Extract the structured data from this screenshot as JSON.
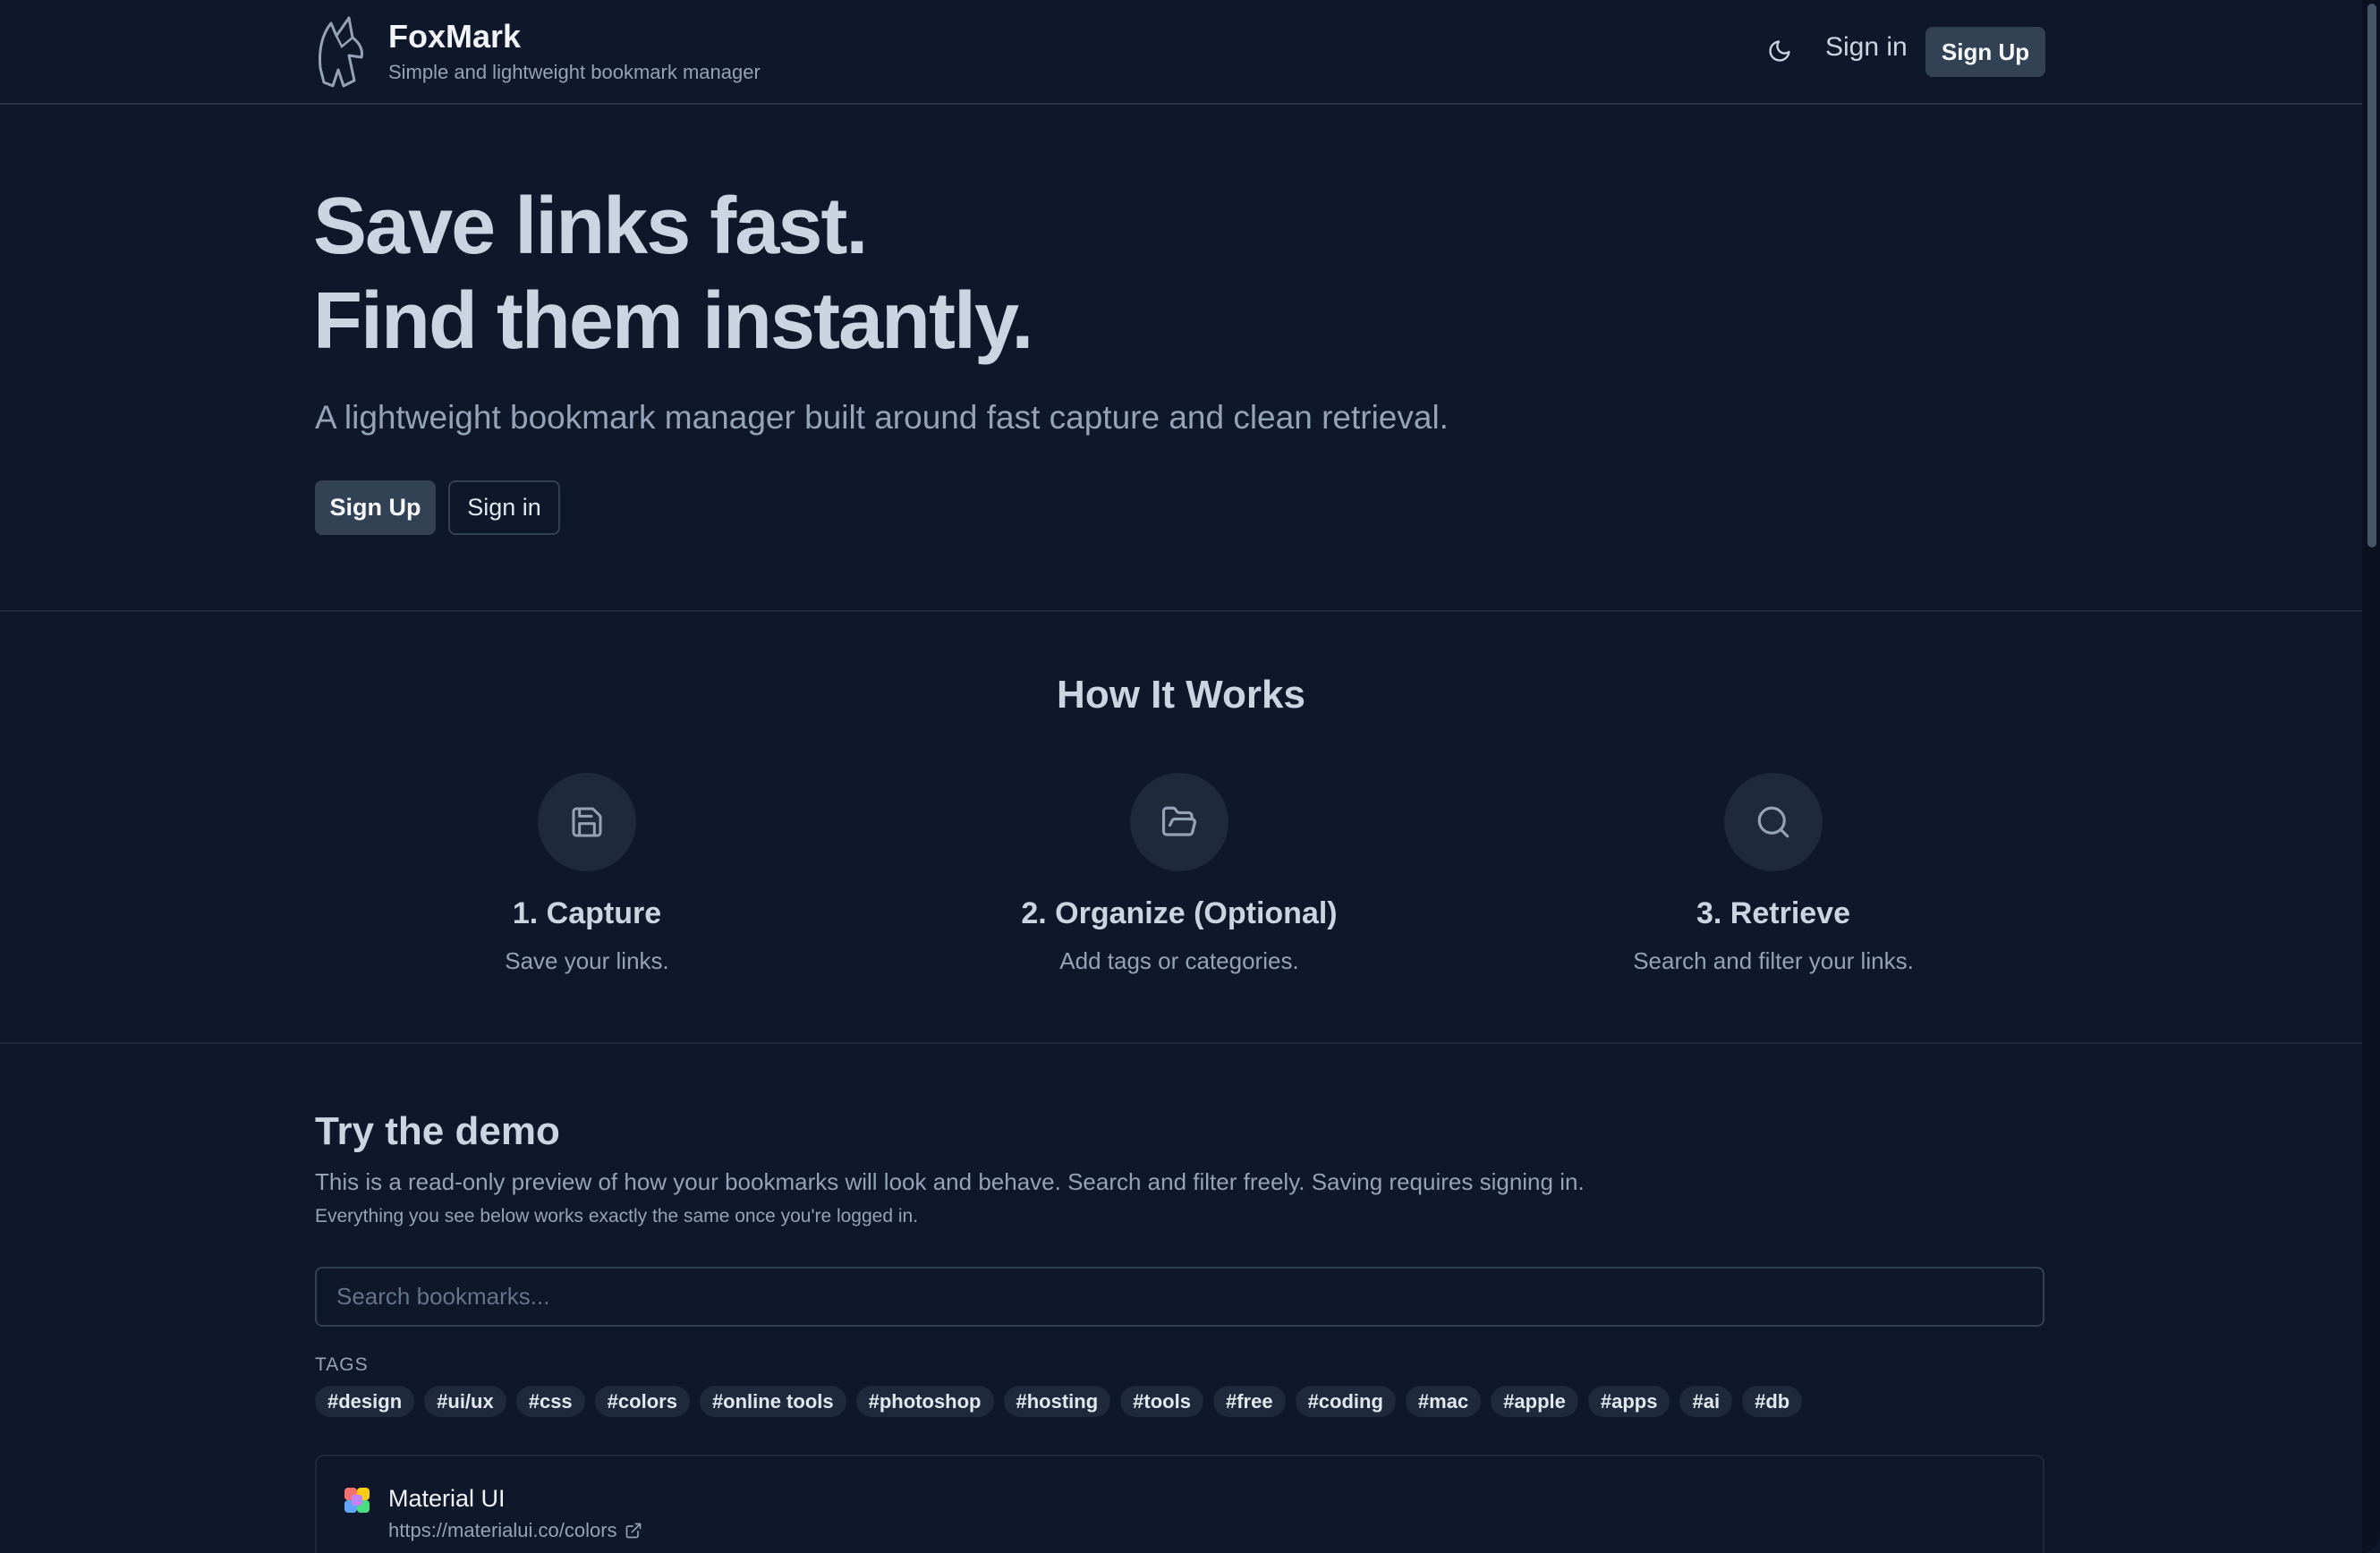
{
  "header": {
    "brand_name": "FoxMark",
    "brand_tagline": "Simple and lightweight bookmark manager",
    "theme_icon": "moon-icon",
    "signin_label": "Sign in",
    "signup_label": "Sign Up"
  },
  "hero": {
    "title_line1": "Save links fast.",
    "title_line2": "Find them instantly.",
    "subtitle": "A lightweight bookmark manager built around fast capture and clean retrieval.",
    "signup_label": "Sign Up",
    "signin_label": "Sign in"
  },
  "how_it_works": {
    "title": "How It Works",
    "steps": [
      {
        "icon": "save-icon",
        "title": "1. Capture",
        "desc": "Save your links."
      },
      {
        "icon": "folder-open-icon",
        "title": "2. Organize (Optional)",
        "desc": "Add tags or categories."
      },
      {
        "icon": "search-icon",
        "title": "3. Retrieve",
        "desc": "Search and filter your links."
      }
    ]
  },
  "demo": {
    "title": "Try the demo",
    "description": "This is a read-only preview of how your bookmarks will look and behave. Search and filter freely. Saving requires signing in.",
    "note": "Everything you see below works exactly the same once you're logged in.",
    "search_placeholder": "Search bookmarks...",
    "tags_label": "TAGS",
    "tags": [
      "#design",
      "#ui/ux",
      "#css",
      "#colors",
      "#online tools",
      "#photoshop",
      "#hosting",
      "#tools",
      "#free",
      "#coding",
      "#mac",
      "#apple",
      "#apps",
      "#ai",
      "#db"
    ],
    "bookmarks": [
      {
        "title": "Material UI",
        "url": "https://materialui.co/colors"
      }
    ]
  },
  "colors": {
    "background": "#0f172a",
    "surface": "#1e293b",
    "button": "#334155",
    "text_muted": "#94a3b8"
  }
}
